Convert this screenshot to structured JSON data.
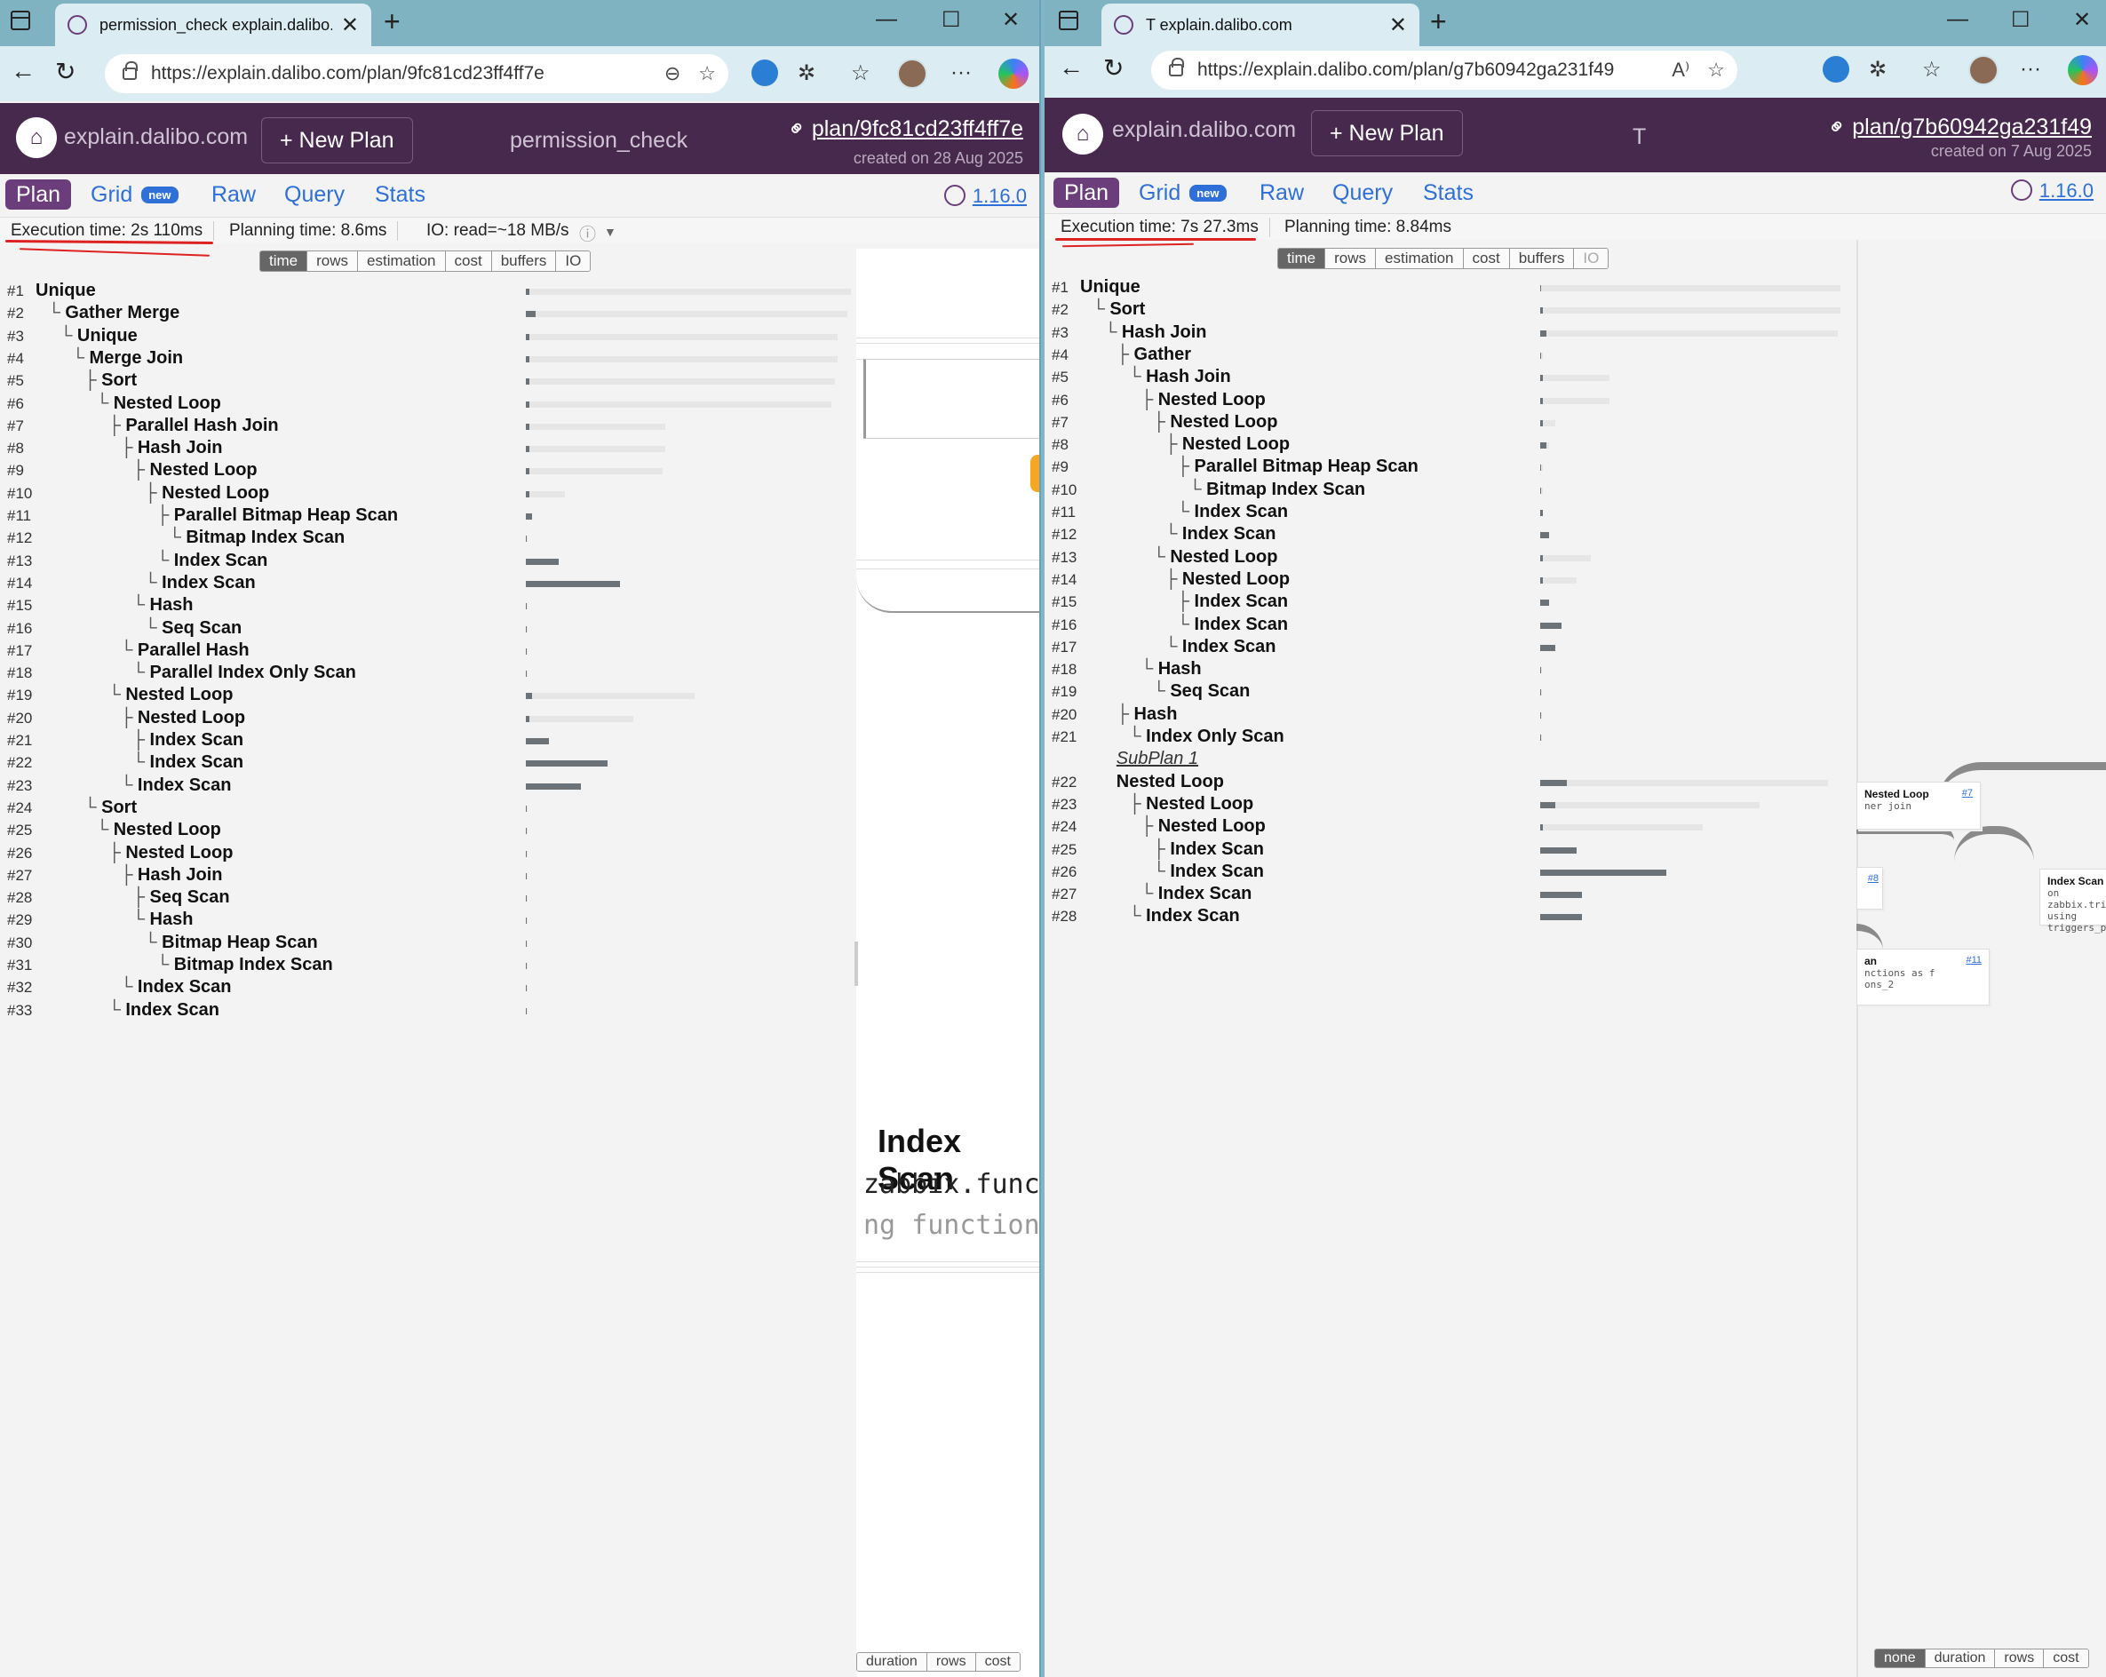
{
  "left": {
    "tab_title": "permission_check explain.dalibo.c",
    "url": "https://explain.dalibo.com/plan/9fc81cd23ff4ff7e",
    "brand": "explain.dalibo.com",
    "new_plan": "+ New Plan",
    "plan_title": "permission_check",
    "plan_link": "plan/9fc81cd23ff4ff7e",
    "created": "created on 28 Aug 2025",
    "nav": [
      "Plan",
      "Grid",
      "Raw",
      "Query",
      "Stats"
    ],
    "badge": "new",
    "version": "1.16.0",
    "execution_time": "Execution time: 2s 110ms",
    "planning_time": "Planning time:  8.6ms",
    "io": "IO: read=~18 MB/s",
    "metric_buttons": [
      "time",
      "rows",
      "estimation",
      "cost",
      "buffers",
      "IO"
    ],
    "diagram_buttons": [
      "duration",
      "rows",
      "cost"
    ],
    "diagram_node_title": "Index Scan",
    "diagram_mono_1": "zabbix.funct",
    "diagram_mono_2": "ng functions",
    "nodes": [
      {
        "n": "#1",
        "name": "Unique",
        "tree": "",
        "depth": 0,
        "time": 0.01
      },
      {
        "n": "#2",
        "name": "Gather Merge",
        "tree": "└",
        "depth": 1,
        "time": 0.03
      },
      {
        "n": "#3",
        "name": "Unique",
        "tree": "└",
        "depth": 2,
        "time": 0.01
      },
      {
        "n": "#4",
        "name": "Merge Join",
        "tree": "└",
        "depth": 3,
        "time": 0.01
      },
      {
        "n": "#5",
        "name": "Sort",
        "tree": "├",
        "depth": 4,
        "time": 0.01
      },
      {
        "n": "#6",
        "name": "Nested Loop",
        "tree": "└",
        "depth": 5,
        "time": 0.01
      },
      {
        "n": "#7",
        "name": "Parallel Hash Join",
        "tree": "├",
        "depth": 6,
        "time": 0.01
      },
      {
        "n": "#8",
        "name": "Hash Join",
        "tree": "├",
        "depth": 7,
        "time": 0.01
      },
      {
        "n": "#9",
        "name": "Nested Loop",
        "tree": "├",
        "depth": 8,
        "time": 0.01
      },
      {
        "n": "#10",
        "name": "Nested Loop",
        "tree": "├",
        "depth": 9,
        "time": 0.01
      },
      {
        "n": "#11",
        "name": "Parallel Bitmap Heap Scan",
        "tree": "├",
        "depth": 10,
        "time": 0.02
      },
      {
        "n": "#12",
        "name": "Bitmap Index Scan",
        "tree": "└",
        "depth": 11,
        "time": 0.0
      },
      {
        "n": "#13",
        "name": "Index Scan",
        "tree": "└",
        "depth": 10,
        "time": 0.1
      },
      {
        "n": "#14",
        "name": "Index Scan",
        "tree": "└",
        "depth": 9,
        "time": 0.29
      },
      {
        "n": "#15",
        "name": "Hash",
        "tree": "└",
        "depth": 8,
        "time": 0.0
      },
      {
        "n": "#16",
        "name": "Seq Scan",
        "tree": "└",
        "depth": 9,
        "time": 0.0
      },
      {
        "n": "#17",
        "name": "Parallel Hash",
        "tree": "└",
        "depth": 7,
        "time": 0.0
      },
      {
        "n": "#18",
        "name": "Parallel Index Only Scan",
        "tree": "└",
        "depth": 8,
        "time": 0.0
      },
      {
        "n": "#19",
        "name": "Nested Loop",
        "tree": "└",
        "depth": 6,
        "time": 0.02
      },
      {
        "n": "#20",
        "name": "Nested Loop",
        "tree": "├",
        "depth": 7,
        "time": 0.01
      },
      {
        "n": "#21",
        "name": "Index Scan",
        "tree": "├",
        "depth": 8,
        "time": 0.07
      },
      {
        "n": "#22",
        "name": "Index Scan",
        "tree": "└",
        "depth": 8,
        "time": 0.25
      },
      {
        "n": "#23",
        "name": "Index Scan",
        "tree": "└",
        "depth": 7,
        "time": 0.17
      },
      {
        "n": "#24",
        "name": "Sort",
        "tree": "└",
        "depth": 4,
        "time": 0.0
      },
      {
        "n": "#25",
        "name": "Nested Loop",
        "tree": "└",
        "depth": 5,
        "time": 0.0
      },
      {
        "n": "#26",
        "name": "Nested Loop",
        "tree": "├",
        "depth": 6,
        "time": 0.0
      },
      {
        "n": "#27",
        "name": "Hash Join",
        "tree": "├",
        "depth": 7,
        "time": 0.0
      },
      {
        "n": "#28",
        "name": "Seq Scan",
        "tree": "├",
        "depth": 8,
        "time": 0.0
      },
      {
        "n": "#29",
        "name": "Hash",
        "tree": "└",
        "depth": 8,
        "time": 0.0
      },
      {
        "n": "#30",
        "name": "Bitmap Heap Scan",
        "tree": "└",
        "depth": 9,
        "time": 0.0
      },
      {
        "n": "#31",
        "name": "Bitmap Index Scan",
        "tree": "└",
        "depth": 10,
        "time": 0.0
      },
      {
        "n": "#32",
        "name": "Index Scan",
        "tree": "└",
        "depth": 7,
        "time": 0.0
      },
      {
        "n": "#33",
        "name": "Index Scan",
        "tree": "└",
        "depth": 6,
        "time": 0.0
      }
    ],
    "totals": [
      1.0,
      0.99,
      0.96,
      0.96,
      0.95,
      0.94,
      0.43,
      0.43,
      0.42,
      0.12,
      0.02,
      0.0,
      0.1,
      0.29,
      0.0,
      0.0,
      0.0,
      0.0,
      0.52,
      0.33,
      0.07,
      0.25,
      0.17,
      0.0,
      0.0,
      0.0,
      0.0,
      0.0,
      0.0,
      0.0,
      0.0,
      0.0,
      0.0
    ]
  },
  "right": {
    "tab_title": "T explain.dalibo.com",
    "url": "https://explain.dalibo.com/plan/g7b60942ga231f49",
    "brand": "explain.dalibo.com",
    "new_plan": "+ New Plan",
    "plan_title": "T",
    "plan_link": "plan/g7b60942ga231f49",
    "created": "created on 7 Aug 2025",
    "nav": [
      "Plan",
      "Grid",
      "Raw",
      "Query",
      "Stats"
    ],
    "badge": "new",
    "version": "1.16.0",
    "execution_time": "Execution time: 7s 27.3ms",
    "planning_time": "Planning time:  8.84ms",
    "metric_buttons": [
      "time",
      "rows",
      "estimation",
      "cost",
      "buffers",
      "IO"
    ],
    "diagram_buttons": [
      "none",
      "duration",
      "rows",
      "cost"
    ],
    "diagram_nodes": [
      {
        "title": "Nested Loop",
        "link": "#7",
        "line": "ner join"
      },
      {
        "title": "Index Scan",
        "line": "on zabbix.triggers",
        "line2": "using triggers_pkey"
      },
      {
        "title": "an",
        "link": "#11",
        "line": "nctions as f",
        "line2": "ons_2"
      },
      {
        "title": "",
        "link": "#8"
      }
    ],
    "nodes": [
      {
        "n": "#1",
        "name": "Unique",
        "tree": "",
        "depth": 0,
        "time": 0.0
      },
      {
        "n": "#2",
        "name": "Sort",
        "tree": "└",
        "depth": 1,
        "time": 0.01
      },
      {
        "n": "#3",
        "name": "Hash Join",
        "tree": "└",
        "depth": 2,
        "time": 0.02
      },
      {
        "n": "#4",
        "name": "Gather",
        "tree": "├",
        "depth": 3,
        "time": 0.0
      },
      {
        "n": "#5",
        "name": "Hash Join",
        "tree": "└",
        "depth": 4,
        "time": 0.01
      },
      {
        "n": "#6",
        "name": "Nested Loop",
        "tree": "├",
        "depth": 5,
        "time": 0.01
      },
      {
        "n": "#7",
        "name": "Nested Loop",
        "tree": "├",
        "depth": 6,
        "time": 0.01
      },
      {
        "n": "#8",
        "name": "Nested Loop",
        "tree": "├",
        "depth": 7,
        "time": 0.02
      },
      {
        "n": "#9",
        "name": "Parallel Bitmap Heap Scan",
        "tree": "├",
        "depth": 8,
        "time": 0.0
      },
      {
        "n": "#10",
        "name": "Bitmap Index Scan",
        "tree": "└",
        "depth": 9,
        "time": 0.0
      },
      {
        "n": "#11",
        "name": "Index Scan",
        "tree": "└",
        "depth": 8,
        "time": 0.01
      },
      {
        "n": "#12",
        "name": "Index Scan",
        "tree": "└",
        "depth": 7,
        "time": 0.03
      },
      {
        "n": "#13",
        "name": "Nested Loop",
        "tree": "└",
        "depth": 6,
        "time": 0.01
      },
      {
        "n": "#14",
        "name": "Nested Loop",
        "tree": "├",
        "depth": 7,
        "time": 0.01
      },
      {
        "n": "#15",
        "name": "Index Scan",
        "tree": "├",
        "depth": 8,
        "time": 0.03
      },
      {
        "n": "#16",
        "name": "Index Scan",
        "tree": "└",
        "depth": 8,
        "time": 0.07
      },
      {
        "n": "#17",
        "name": "Index Scan",
        "tree": "└",
        "depth": 7,
        "time": 0.05
      },
      {
        "n": "#18",
        "name": "Hash",
        "tree": "└",
        "depth": 5,
        "time": 0.0
      },
      {
        "n": "#19",
        "name": "Seq Scan",
        "tree": "└",
        "depth": 6,
        "time": 0.0
      },
      {
        "n": "#20",
        "name": "Hash",
        "tree": "├",
        "depth": 3,
        "time": 0.0
      },
      {
        "n": "#21",
        "name": "Index Only Scan",
        "tree": "└",
        "depth": 4,
        "time": 0.0
      },
      {
        "n": "",
        "name": "SubPlan 1",
        "tree": "",
        "depth": 3,
        "time": -1,
        "sub": true
      },
      {
        "n": "#22",
        "name": "Nested Loop",
        "tree": "",
        "depth": 3,
        "time": 0.09
      },
      {
        "n": "#23",
        "name": "Nested Loop",
        "tree": "├",
        "depth": 4,
        "time": 0.05
      },
      {
        "n": "#24",
        "name": "Nested Loop",
        "tree": "├",
        "depth": 5,
        "time": 0.01
      },
      {
        "n": "#25",
        "name": "Index Scan",
        "tree": "├",
        "depth": 6,
        "time": 0.12
      },
      {
        "n": "#26",
        "name": "Index Scan",
        "tree": "└",
        "depth": 6,
        "time": 0.42
      },
      {
        "n": "#27",
        "name": "Index Scan",
        "tree": "└",
        "depth": 5,
        "time": 0.14
      },
      {
        "n": "#28",
        "name": "Index Scan",
        "tree": "└",
        "depth": 4,
        "time": 0.14
      }
    ],
    "totals": [
      1.0,
      1.0,
      0.99,
      0.01,
      0.23,
      0.23,
      0.05,
      0.03,
      0.01,
      0.01,
      0.01,
      0.03,
      0.17,
      0.12,
      0.03,
      0.07,
      0.05,
      0.0,
      0.0,
      0.0,
      0.0,
      -1,
      0.96,
      0.73,
      0.54,
      0.12,
      0.42,
      0.14,
      0.14
    ]
  }
}
